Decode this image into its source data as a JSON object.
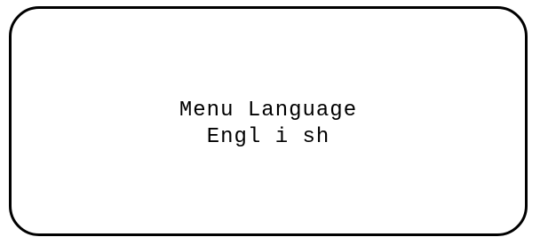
{
  "display": {
    "title": "Menu Language",
    "value": "Engl i sh"
  },
  "colors": {
    "background": "#ffffff",
    "border": "#000000",
    "text": "#000000"
  }
}
